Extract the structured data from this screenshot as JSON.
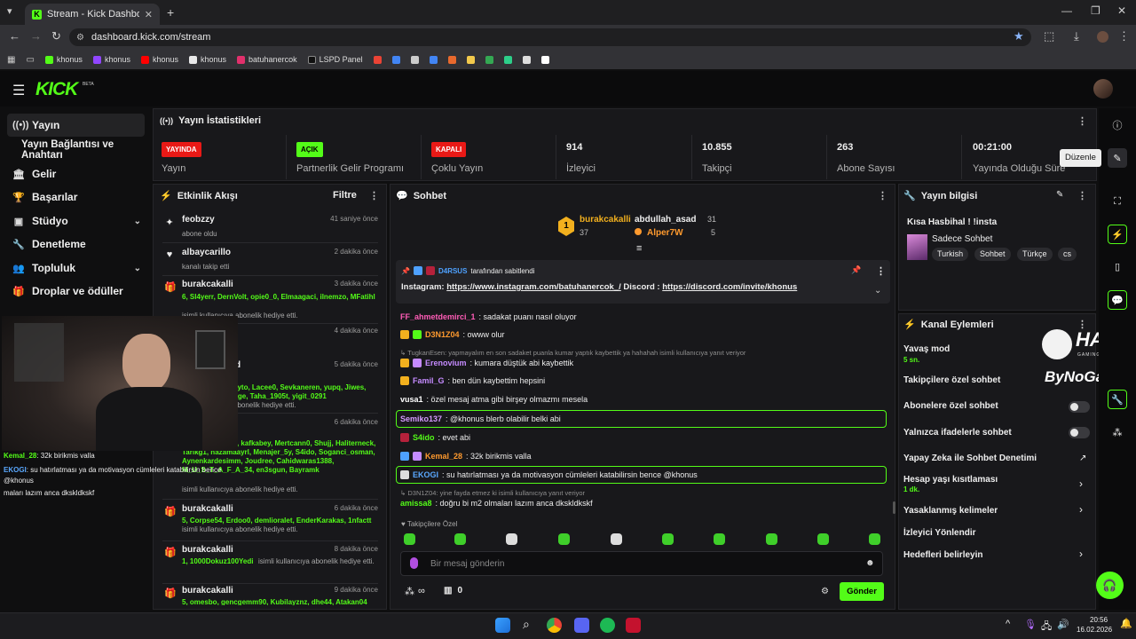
{
  "browser": {
    "tab_title": "Stream - Kick Dashboard",
    "url": "dashboard.kick.com/stream",
    "bookmarks": [
      {
        "label": "khonus",
        "color": "#53fc18"
      },
      {
        "label": "khonus",
        "color": "#9146ff"
      },
      {
        "label": "khonus",
        "color": "#ff0000"
      },
      {
        "label": "khonus",
        "color": "#e8e8e8"
      },
      {
        "label": "batuhanercok",
        "color": "#e1306c"
      },
      {
        "label": "LSPD Panel",
        "color": "#1a1a1a"
      }
    ]
  },
  "header": {
    "logo": "KICK",
    "beta": "BETA"
  },
  "sidebar": {
    "items": [
      {
        "label": "Yayın",
        "icon": "broadcast-icon"
      },
      {
        "label": "Yayın Bağlantısı ve Anahtarı",
        "icon": ""
      },
      {
        "label": "Gelir",
        "icon": "bank-icon"
      },
      {
        "label": "Başarılar",
        "icon": "trophy-icon"
      },
      {
        "label": "Stüdyo",
        "icon": "studio-icon"
      },
      {
        "label": "Denetleme",
        "icon": "wrench-icon"
      },
      {
        "label": "Topluluk",
        "icon": "people-icon"
      },
      {
        "label": "Droplar ve ödüller",
        "icon": "gift-icon"
      }
    ]
  },
  "stats": {
    "title": "Yayın İstatistikleri",
    "items": [
      {
        "badge": "YAYINDA",
        "label": "Yayın",
        "badge_color": "#e91916"
      },
      {
        "badge": "AÇIK",
        "label": "Partnerlik Gelir Programı",
        "badge_color": "#53fc18"
      },
      {
        "badge": "KAPALI",
        "label": "Çoklu Yayın",
        "badge_color": "#e91916"
      },
      {
        "value": "914",
        "label": "İzleyici"
      },
      {
        "value": "10.855",
        "label": "Takipçi"
      },
      {
        "value": "263",
        "label": "Abone Sayısı"
      },
      {
        "value": "00:21:00",
        "label": "Yayında Olduğu Süre"
      }
    ],
    "tooltip": "Düzenle"
  },
  "feed": {
    "title": "Etkinlik Akışı",
    "filter": "Filtre",
    "rows": [
      {
        "name": "feobzzy",
        "time": "41 saniye önce",
        "sub": "abone oldu",
        "green": ""
      },
      {
        "name": "albaycarillo",
        "time": "2 dakika önce",
        "sub": "kanalı takip etti",
        "green": ""
      },
      {
        "name": "burakcakalli",
        "time": "3 dakika önce",
        "green": "6, Sl4yerr, DernVolt, opie0_0, Elmaagaci, ilnemzo, MFatihl",
        "sub": "isimli kullanıcıya abonelik hediye etti."
      },
      {
        "name": "",
        "time": "4 dakika önce",
        "sub": "",
        "green": ""
      },
      {
        "name": "d",
        "time": "5 dakika önce",
        "green": "ayto, Lacee0, Sevkaneren, yupq, Jiwes, nge, Taha_1905t, yigit_0291",
        "sub": "abonelik hediye etti."
      },
      {
        "name": "",
        "time": "6 dakika önce",
        "green": "ckirbtw, JIR_ALI, kafkabey, Mertcann0, Shujj, Haliterneck, Tarikg1, nazamaayrl, Menajer_5y, S4ido, Soganci_osman, Aynenkardesimm, Joudree, Cahidwaras1388, M_U_S_T_A_F_A_34, en3sgun, Bayramk",
        "sub": "isimli kullanıcıya abonelik hediye etti."
      },
      {
        "name": "burakcakalli",
        "time": "6 dakika önce",
        "green": "5, Corpse54, Erdoo0, demlioralet, EnderKarakas, 1nfactt",
        "sub": "isimli kullanıcıya abonelik hediye etti."
      },
      {
        "name": "burakcakalli",
        "time": "8 dakika önce",
        "green": "1, 1000Dokuz100Yedi",
        "sub": "isimli kullanıcıya abonelik hediye etti."
      },
      {
        "name": "burakcakalli",
        "time": "9 dakika önce",
        "green": "5, omesbo, gencgemm90, Kubilayznz, dhe44, Atakan04",
        "sub": ""
      }
    ]
  },
  "chat": {
    "title": "Sohbet",
    "leaders": [
      {
        "rank": "1",
        "name": "burakcakalli",
        "count": "37"
      },
      {
        "name": "abdullah_asad",
        "count": "31"
      },
      {
        "name": "Alper7W",
        "count": "5"
      }
    ],
    "pinned_by_user": "D4RSUS",
    "pinned_by_suffix": "tarafından sabitlendi",
    "pinned_text_prefix": "Instagram:",
    "pinned_link1": "https://www.instagram.com/batuhanercok_/",
    "pinned_mid": "Discord :",
    "pinned_link2": "https://discord.com/invite/khonus",
    "messages": [
      {
        "user": "FF_ahmetdemirci_1",
        "color": "#ff5cb7",
        "text": ": sadakat puanı nasıl oluyor"
      },
      {
        "user": "D3N1Z04",
        "color": "#ff9a2e",
        "text": ": owww olur"
      },
      {
        "reply": "TugkanEsen: yapmayalım en son sadaket puanla kumar yaptık kaybettik ya hahahah isimli kullanıcıya yanıt veriyor"
      },
      {
        "user": "Erenovium",
        "color": "#c58bff",
        "text": ": kumara düştük abi kaybettik"
      },
      {
        "user": "Famil_G",
        "color": "#c58bff",
        "text": ": ben dün kaybettim hepsini"
      },
      {
        "user": "vusa1",
        "color": "#ffffff",
        "text": ": özel mesaj atma gibi birşey olmazmı mesela"
      },
      {
        "user": "Semiko137",
        "color": "#d59bff",
        "text": ": @khonus blerb olabilir belki abi"
      },
      {
        "user": "S4ido",
        "color": "#53fc18",
        "text": ": evet abi"
      },
      {
        "user": "Kemal_28",
        "color": "#ff9a2e",
        "text": ": 32k birikmis valla"
      },
      {
        "user": "EKOGI",
        "color": "#5aa8ff",
        "text": ": su hatırlatması ya da motivasyon cümleleri katabilirsin bence @khonus"
      },
      {
        "reply": "D3N1Z04: yine fayda etmez ki isimli kullanıcıya yanıt veriyor"
      },
      {
        "user": "amissa8",
        "color": "#53fc18",
        "text": ": doğru bi m2 olmaları lazım anca dkskldkskf"
      }
    ],
    "followers_label": "Takipçilere Özel",
    "input_placeholder": "Bir mesaj gönderin",
    "points": "∞",
    "gift_count": "0",
    "send": "Gönder"
  },
  "info": {
    "title": "Yayın bilgisi",
    "stream_title": "Kısa Hasbihal ! !insta",
    "category": "Sadece Sohbet",
    "tags": [
      "Turkish",
      "Sohbet",
      "Türkçe",
      "cs"
    ]
  },
  "actions": {
    "title": "Kanal Eylemleri",
    "slow_mode": "Yavaş mod",
    "slow_value": "5 sn.",
    "followers_chat": "Takipçilere özel sohbet",
    "subs_chat": "Abonelere özel sohbet",
    "emote_chat": "Yalnızca ifadelerle sohbet",
    "ai_mod": "Yapay Zeka ile Sohbet Denetimi",
    "account_age": "Hesap yaşı kısıtlaması",
    "account_age_value": "1 dk.",
    "banned_words": "Yasaklanmış kelimeler",
    "raid": "İzleyici Yönlendir",
    "goals": "Hedefleri belirleyin"
  },
  "overlay": {
    "sponsor1": "HAWK",
    "sponsor1_sub": "GAMING CHAIR",
    "sponsor2": "ByNoGame",
    "cam_lines": [
      {
        "user": "Kemal_28",
        "text": ": 32k birikmis valla"
      },
      {
        "user": "EKOGI",
        "text": ": su hatırlatması ya da motivasyon cümleleri katabilirsin bence @khonus"
      },
      {
        "user": "",
        "text": "maları lazım anca dkskldkskf"
      }
    ]
  },
  "taskbar": {
    "time": "20:56",
    "date": "16.02.2026"
  }
}
